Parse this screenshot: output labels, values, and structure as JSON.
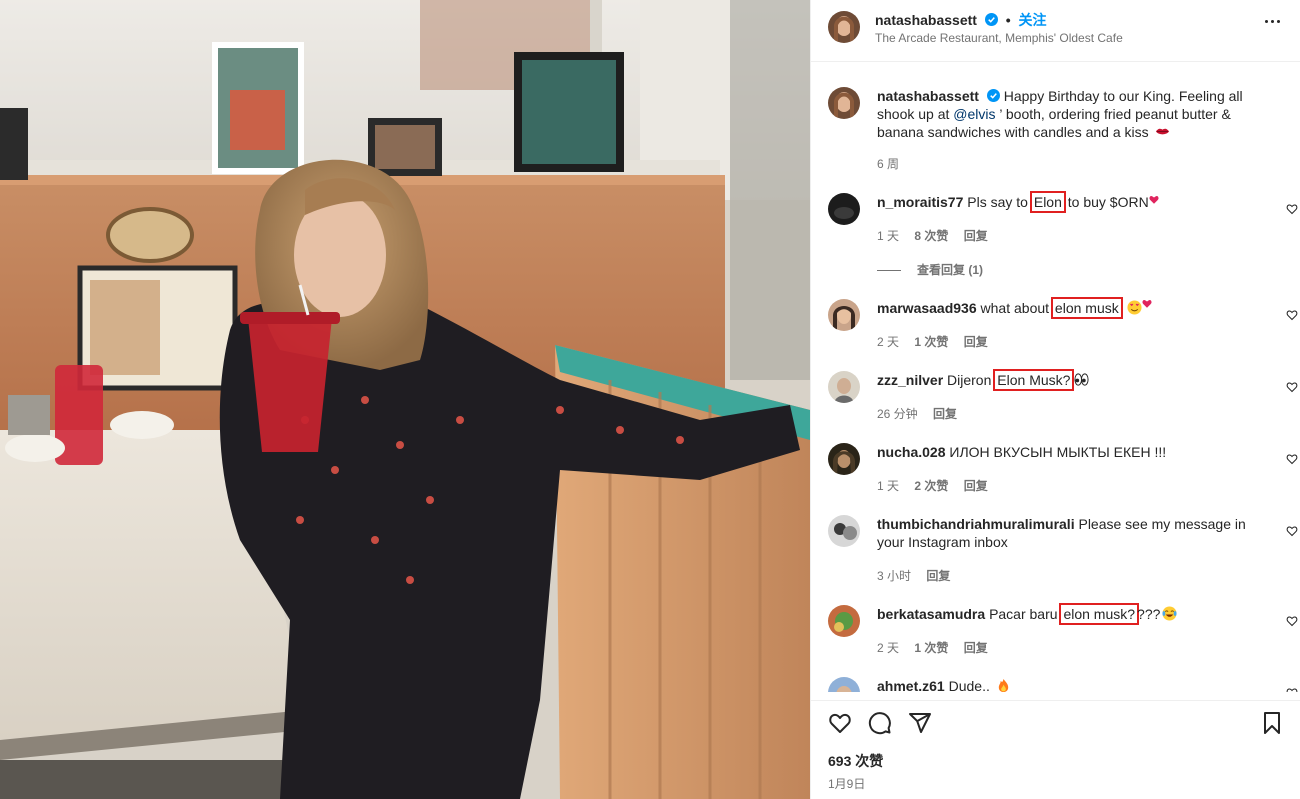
{
  "header": {
    "username": "natashabassett",
    "separator": "•",
    "follow_label": "关注",
    "location": "The Arcade Restaurant, Memphis' Oldest Cafe"
  },
  "caption": {
    "username": "natashabassett",
    "text_before": "Happy Birthday to our King. Feeling all shook up at ",
    "mention": "@elvis",
    "text_after": " ’ booth, ordering fried peanut butter & banana sandwiches with candles and a kiss",
    "age": "6 周"
  },
  "comments": [
    {
      "username": "n_moraitis77",
      "pre": "Pls say to ",
      "highlight": "Elon",
      "post": " to buy $ORN",
      "age": "1 天",
      "likes": "8 次赞",
      "reply": "回复",
      "emoji": "heart"
    },
    {
      "username": "marwasaad936",
      "pre": "what about ",
      "highlight": "elon musk",
      "post": " ",
      "age": "2 天",
      "likes": "1 次赞",
      "reply": "回复",
      "emoji": "heart-eyes"
    },
    {
      "username": "zzz_nilver",
      "pre": "Dijeron ",
      "highlight": "Elon Musk?",
      "post": "",
      "age": "26 分钟",
      "likes": "",
      "reply": "回复",
      "emoji": "eyes"
    },
    {
      "username": "nucha.028",
      "pre": "ИЛОН ВКУСЫН МЫКТЫ ЕКЕН !!!",
      "highlight": "",
      "post": "",
      "age": "1 天",
      "likes": "2 次赞",
      "reply": "回复",
      "emoji": ""
    },
    {
      "username": "thumbichandriahmuralimurali",
      "pre": "Please see my message in your Instagram inbox",
      "highlight": "",
      "post": "",
      "age": "3 小时",
      "likes": "",
      "reply": "回复",
      "emoji": ""
    },
    {
      "username": "berkatasamudra",
      "pre": "Pacar baru ",
      "highlight": "elon musk?",
      "post": "???",
      "age": "2 天",
      "likes": "1 次赞",
      "reply": "回复",
      "emoji": "tears"
    },
    {
      "username": "ahmet.z61",
      "pre": "Dude.. ",
      "highlight": "",
      "post": "",
      "age": "",
      "likes": "",
      "reply": "",
      "emoji": "fire"
    }
  ],
  "view_replies": "查看回复 (1)",
  "actions": {
    "like_count": "693 次赞",
    "date": "1月9日",
    "icons": [
      "heart-icon",
      "comment-icon",
      "share-icon",
      "bookmark-icon"
    ]
  },
  "colors": {
    "link": "#0095f6",
    "highlight": "#e02020",
    "meta": "#737373"
  }
}
